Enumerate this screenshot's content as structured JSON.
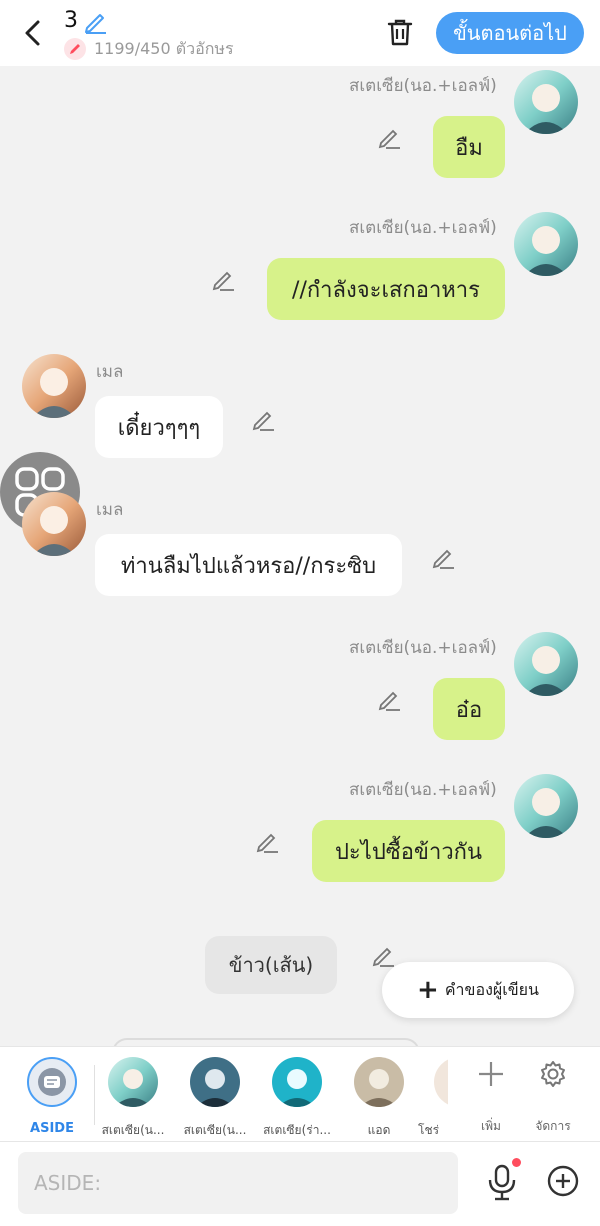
{
  "header": {
    "title": "3",
    "char_count": "1199/450 ตัวอักษร",
    "next_label": "ขั้นตอนต่อไป"
  },
  "messages": [
    {
      "side": "right",
      "name": "สเตเซีย(นอ.+เอลฟ์)",
      "text": "อืม",
      "avatar": "teal"
    },
    {
      "side": "right",
      "name": "สเตเซีย(นอ.+เอลฟ์)",
      "text": "//กำลังจะเสกอาหาร",
      "avatar": "teal"
    },
    {
      "side": "left",
      "name": "เมล",
      "text": "เดี๋ยวๆๆๆ",
      "avatar": "orange"
    },
    {
      "side": "left",
      "name": "เมล",
      "text": "ท่านลืมไปแล้วหรอ//กระซิบ",
      "avatar": "orange"
    },
    {
      "side": "right",
      "name": "สเตเซีย(นอ.+เอลฟ์)",
      "text": "อ๋อ",
      "avatar": "teal"
    },
    {
      "side": "right",
      "name": "สเตเซีย(นอ.+เอลฟ์)",
      "text": "ปะไปซื้อข้าวกัน",
      "avatar": "teal"
    }
  ],
  "narration": {
    "text": "ข้าว(เส้น)"
  },
  "author_button": {
    "label": "คำของผู้เขียน",
    "icon": "plus-icon"
  },
  "characters": [
    {
      "label": "ASIDE",
      "kind": "aside"
    },
    {
      "label": "สเตเซีย(น...",
      "kind": "teal"
    },
    {
      "label": "สเตเซีย(น...",
      "kind": "teal-dark"
    },
    {
      "label": "สเตเซีย(ร่า...",
      "kind": "teal-bright"
    },
    {
      "label": "แอด",
      "kind": "sepia"
    },
    {
      "label": "โชร่",
      "kind": "partial"
    }
  ],
  "tools": {
    "add_label": "เพิ่ม",
    "manage_label": "จัดการ"
  },
  "input": {
    "placeholder": "ASIDE:"
  },
  "colors": {
    "accent": "#4a9ff5",
    "bubble_right": "#d7f28a",
    "bubble_left": "#ffffff",
    "notification_dot": "#ff4d5e"
  }
}
